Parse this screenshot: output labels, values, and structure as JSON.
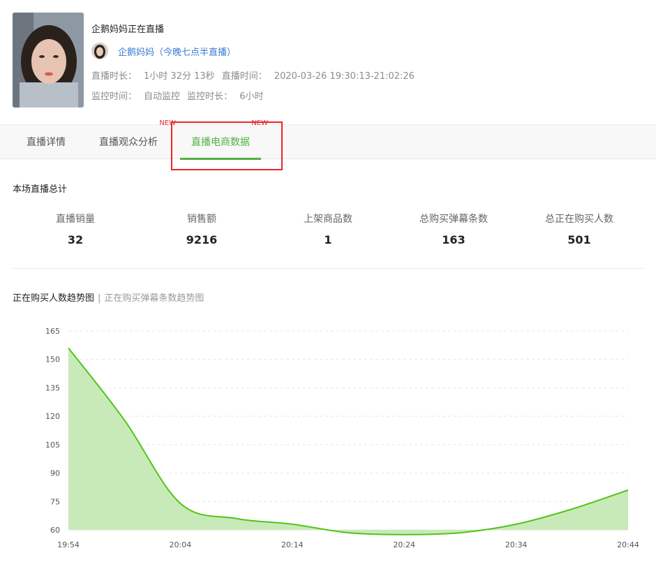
{
  "live": {
    "title": "企鹅妈妈正在直播",
    "anchor_name": "企鹅妈妈（今晚七点半直播）",
    "duration_label": "直播时长：",
    "duration_value": "1小时 32分 13秒",
    "time_label": "直播时间：",
    "time_value": "2020-03-26 19:30:13-21:02:26",
    "monitor_label": "监控时间：",
    "monitor_value": "自动监控",
    "monitor_duration_label": "监控时长：",
    "monitor_duration_value": "6小时"
  },
  "tabs": [
    {
      "label": "直播详情",
      "new": ""
    },
    {
      "label": "直播观众分析",
      "new": "NEW"
    },
    {
      "label": "直播电商数据",
      "new": "NEW",
      "active": true
    }
  ],
  "summary": {
    "title": "本场直播总计",
    "stats": [
      {
        "label": "直播销量",
        "value": "32"
      },
      {
        "label": "销售额",
        "value": "9216"
      },
      {
        "label": "上架商品数",
        "value": "1"
      },
      {
        "label": "总购买弹幕条数",
        "value": "163"
      },
      {
        "label": "总正在购买人数",
        "value": "501"
      }
    ]
  },
  "chart_tabs": {
    "active": "正在购买人数趋势图",
    "separator": "|",
    "inactive": "正在购买弹幕条数趋势图"
  },
  "colors": {
    "accent": "#52b043",
    "link": "#3a7bd5",
    "badge": "#e8262a",
    "area_fill": "#c8eab8",
    "line": "#52c41a"
  },
  "chart_data": {
    "type": "area",
    "title": "",
    "xlabel": "",
    "ylabel": "",
    "x": [
      "19:54",
      "19:59",
      "20:04",
      "20:09",
      "20:14",
      "20:19",
      "20:24",
      "20:29",
      "20:34",
      "20:39",
      "20:44"
    ],
    "xticks": [
      "19:54",
      "20:04",
      "20:14",
      "20:24",
      "20:34",
      "20:44"
    ],
    "series": [
      {
        "values": [
          156,
          118,
          74,
          66,
          63,
          58.5,
          57.5,
          58.5,
          63,
          71,
          81
        ]
      }
    ],
    "yticks": [
      60,
      75,
      90,
      105,
      120,
      135,
      150,
      165
    ],
    "ylim": [
      60,
      165
    ],
    "grid": true
  }
}
